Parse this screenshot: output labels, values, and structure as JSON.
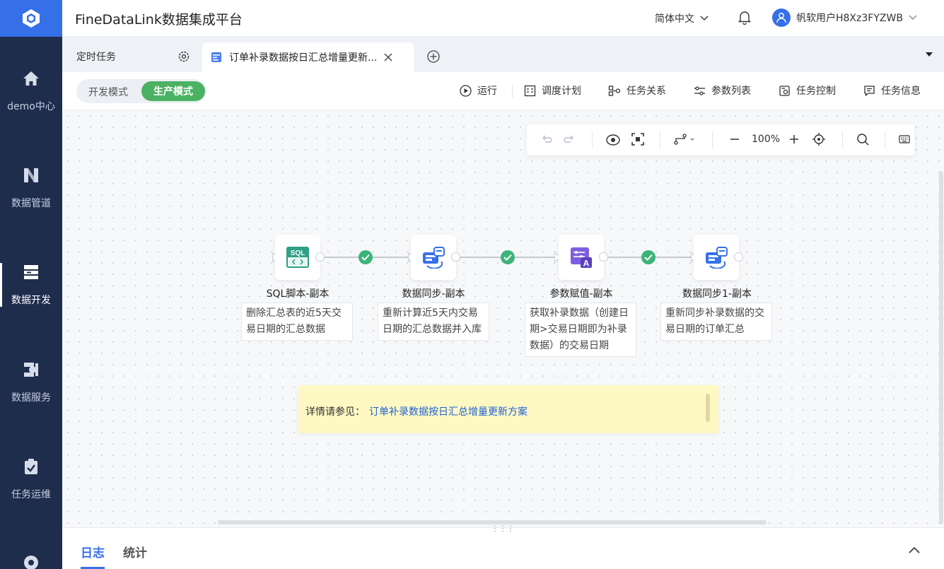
{
  "app": {
    "title": "FineDataLink数据集成平台"
  },
  "header": {
    "language": "简体中文",
    "user_name": "帆软用户H8Xz3FYZWB"
  },
  "sidebar": {
    "items": [
      {
        "label": "demo中心",
        "icon": "home-icon"
      },
      {
        "label": "数据管道",
        "icon": "pipeline-icon"
      },
      {
        "label": "数据开发",
        "icon": "data-dev-icon",
        "active": true
      },
      {
        "label": "数据服务",
        "icon": "data-service-icon"
      },
      {
        "label": "任务运维",
        "icon": "task-ops-icon"
      }
    ]
  },
  "tabs": {
    "items": [
      {
        "label": "定时任务"
      },
      {
        "label": "订单补录数据按日汇总增量更新...",
        "active": true
      }
    ]
  },
  "mode": {
    "dev_label": "开发模式",
    "prod_label": "生产模式",
    "selected": "生产模式"
  },
  "toolbar": {
    "run": "运行",
    "schedule": "调度计划",
    "relations": "任务关系",
    "params": "参数列表",
    "control": "任务控制",
    "info": "任务信息"
  },
  "zoom": {
    "level": "100%"
  },
  "flow": {
    "nodes": [
      {
        "title": "SQL脚本-副本",
        "note": "删除汇总表的近5天交易日期的汇总数据",
        "icon": "sql-script-icon",
        "icon_text": "SQL"
      },
      {
        "title": "数据同步-副本",
        "note": "重新计算近5天内交易日期的汇总数据并入库",
        "icon": "data-sync-icon"
      },
      {
        "title": "参数赋值-副本",
        "note": "获取补录数据（创建日期>交易日期即为补录数据）的交易日期",
        "icon": "param-assign-icon"
      },
      {
        "title": "数据同步1-副本",
        "note": "重新同步补录数据的交易日期的订单汇总",
        "icon": "data-sync-icon"
      }
    ],
    "edges_status": [
      "success",
      "success",
      "success"
    ]
  },
  "hint": {
    "label": "详情请参见：",
    "link": "订单补录数据按日汇总增量更新方案"
  },
  "bottom": {
    "tabs": [
      {
        "label": "日志",
        "active": true
      },
      {
        "label": "统计"
      }
    ]
  },
  "colors": {
    "accent": "#3670e8",
    "sidebar_bg": "#1f2d4d",
    "success": "#3bb47a",
    "prod_mode": "#4ab262",
    "hint_bg": "#fef9c3"
  }
}
